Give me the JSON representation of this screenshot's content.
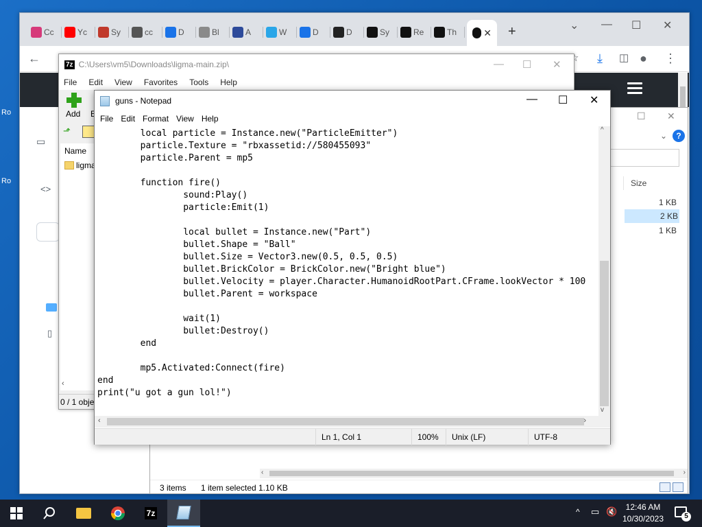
{
  "desktop": {
    "fragments": [
      "Ro",
      "Ro"
    ]
  },
  "chrome": {
    "tabs": [
      {
        "label": "Cc",
        "icon": "app-icon",
        "color": "#d63a7a"
      },
      {
        "label": "Yc",
        "icon": "youtube-icon",
        "color": "#ff0000"
      },
      {
        "label": "Sy",
        "icon": "symbol-icon",
        "color": "#c0392b"
      },
      {
        "label": "cc",
        "icon": "globe-icon",
        "color": "#555555"
      },
      {
        "label": "D",
        "icon": "download-icon",
        "color": "#1a73e8"
      },
      {
        "label": "Bl",
        "icon": "page-icon",
        "color": "#8a8a8a"
      },
      {
        "label": "A",
        "icon": "car-icon",
        "color": "#2d4a9a"
      },
      {
        "label": "W",
        "icon": "drop-icon",
        "color": "#2aa6e8"
      },
      {
        "label": "D",
        "icon": "share-icon",
        "color": "#1a73e8"
      },
      {
        "label": "D",
        "icon": "terminal-icon",
        "color": "#222222"
      },
      {
        "label": "Sy",
        "icon": "code-icon",
        "color": "#111111"
      },
      {
        "label": "Re",
        "icon": "github-icon",
        "color": "#111111"
      },
      {
        "label": "Th",
        "icon": "threads-icon",
        "color": "#111111"
      }
    ],
    "active_tab_close": "✕",
    "new_tab": "+",
    "window_controls": {
      "dropdown": "⌄",
      "minimize": "—",
      "maximize": "☐",
      "close": "✕"
    }
  },
  "sevenzip": {
    "path": "C:\\Users\\vm5\\Downloads\\ligma-main.zip\\",
    "logo": "7z",
    "menu": [
      "File",
      "Edit",
      "View",
      "Favorites",
      "Tools",
      "Help"
    ],
    "toolbar_add": "Add",
    "toolbar_next": "E",
    "column_name": "Name",
    "file": "ligma",
    "status": "0 / 1 obje"
  },
  "explorer": {
    "column_size": "Size",
    "sizes": [
      "1 KB",
      "2 KB",
      "1 KB"
    ],
    "status": {
      "items": "3 items",
      "selected": "1 item selected",
      "size": "1.10 KB"
    }
  },
  "notepad": {
    "title": "guns - Notepad",
    "menu": [
      "File",
      "Edit",
      "Format",
      "View",
      "Help"
    ],
    "code": "        local particle = Instance.new(\"ParticleEmitter\")\n        particle.Texture = \"rbxassetid://580455093\"\n        particle.Parent = mp5\n\n        function fire()\n                sound:Play()\n                particle:Emit(1)\n\n                local bullet = Instance.new(\"Part\")\n                bullet.Shape = \"Ball\"\n                bullet.Size = Vector3.new(0.5, 0.5, 0.5)\n                bullet.BrickColor = BrickColor.new(\"Bright blue\")\n                bullet.Velocity = player.Character.HumanoidRootPart.CFrame.lookVector * 100\n                bullet.Parent = workspace\n\n                wait(1)\n                bullet:Destroy()\n        end\n\n        mp5.Activated:Connect(fire)\nend\nprint(\"u got a gun lol!\")",
    "status": {
      "position": "Ln 1, Col 1",
      "zoom": "100%",
      "line_ending": "Unix (LF)",
      "encoding": "UTF-8"
    }
  },
  "taskbar": {
    "apps": [
      {
        "name": "file-explorer"
      },
      {
        "name": "chrome"
      },
      {
        "name": "7zip",
        "label": "7z"
      },
      {
        "name": "notepad"
      }
    ],
    "clock": {
      "time": "12:46 AM",
      "date": "10/30/2023"
    },
    "notifications": "5"
  },
  "colors": {
    "accent": "#1a73e8",
    "taskbar": "#1a1e29",
    "github_header": "#24292f"
  }
}
